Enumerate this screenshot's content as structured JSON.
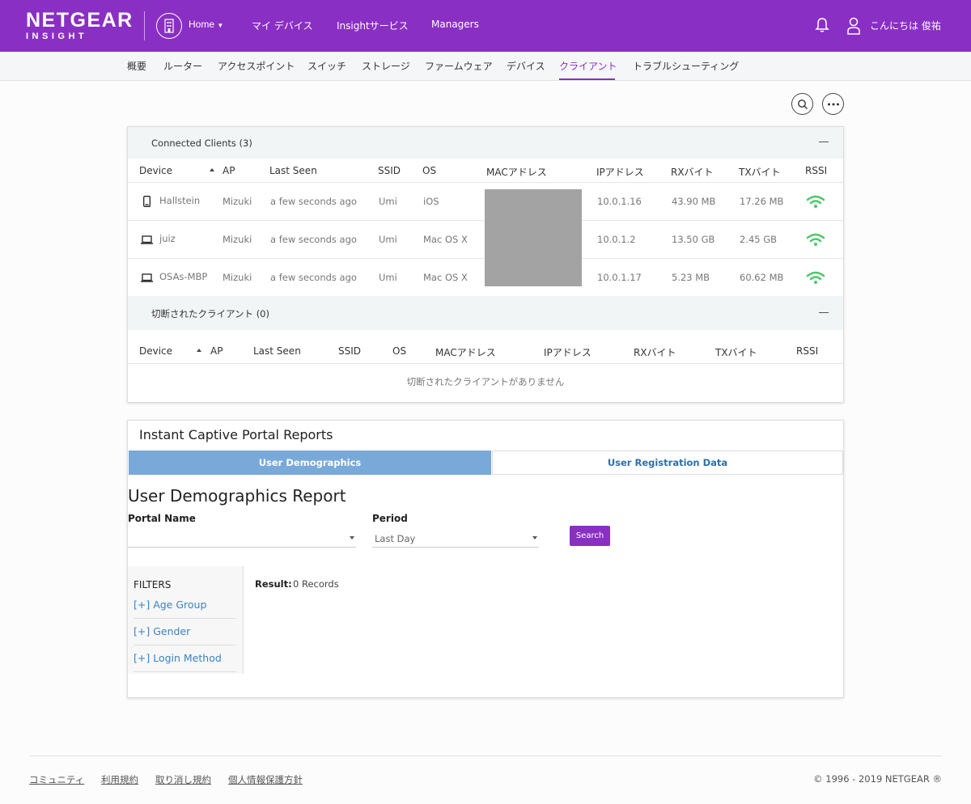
{
  "header": {
    "logo": "NETGEAR",
    "logo_sub": "INSIGHT",
    "home_label": "Home",
    "nav": [
      "マイ デバイス",
      "Insightサービス",
      "Managers"
    ],
    "greeting": "こんにちは 俊祐"
  },
  "subnav": [
    "概要",
    "ルーター",
    "アクセスポイント",
    "スイッチ",
    "ストレージ",
    "ファームウェア",
    "デバイス",
    "クライアント",
    "トラブルシューティング"
  ],
  "subnav_active": "クライアント",
  "connected": {
    "title": "Connected Clients (3)",
    "headers": [
      "Device",
      "AP",
      "Last Seen",
      "SSID",
      "OS",
      "MACアドレス",
      "IPアドレス",
      "RXバイト",
      "TXバイト",
      "RSSI"
    ],
    "rows": [
      {
        "device": "Hallstein",
        "icon": "phone-icon",
        "ap": "Mizuki",
        "last_seen": "a few seconds ago",
        "ssid": "Umi",
        "os": "iOS",
        "ip": "10.0.1.16",
        "rx": "43.90 MB",
        "tx": "17.26 MB"
      },
      {
        "device": "juiz",
        "icon": "laptop-icon",
        "ap": "Mizuki",
        "last_seen": "a few seconds ago",
        "ssid": "Umi",
        "os": "Mac OS X",
        "ip": "10.0.1.2",
        "rx": "13.50 GB",
        "tx": "2.45 GB"
      },
      {
        "device": "OSAs-MBP",
        "icon": "laptop-icon",
        "ap": "Mizuki",
        "last_seen": "a few seconds ago",
        "ssid": "Umi",
        "os": "Mac OS X",
        "ip": "10.0.1.17",
        "rx": "5.23 MB",
        "tx": "60.62 MB"
      }
    ]
  },
  "disconnected": {
    "title": "切断されたクライアント (0)",
    "headers": [
      "Device",
      "AP",
      "Last Seen",
      "SSID",
      "OS",
      "MACアドレス",
      "IPアドレス",
      "RXバイト",
      "TXバイト",
      "RSSI"
    ],
    "empty": "切断されたクライアントがありません"
  },
  "portal": {
    "title": "Instant Captive Portal Reports",
    "tabs": [
      "User Demographics",
      "User Registration Data"
    ],
    "report_title": "User Demographics Report",
    "portal_name_label": "Portal Name",
    "portal_name_value": "",
    "period_label": "Period",
    "period_value": "Last Day",
    "search_label": "Search",
    "filters_title": "FILTERS",
    "filters": [
      "[+] Age Group",
      "[+] Gender",
      "[+] Login Method"
    ],
    "result_label": "Result:",
    "result_value": "0 Records"
  },
  "footer": {
    "links": [
      "コミュニティ",
      "利用規約",
      "取り消し規約",
      "個人情報保護方針"
    ],
    "copyright": "© 1996 - 2019 NETGEAR ®"
  },
  "colors": {
    "brand": "#8a2fc4",
    "tab_active": "#78a9d9",
    "link": "#3a83c3",
    "wifi": "#4cc66a"
  }
}
